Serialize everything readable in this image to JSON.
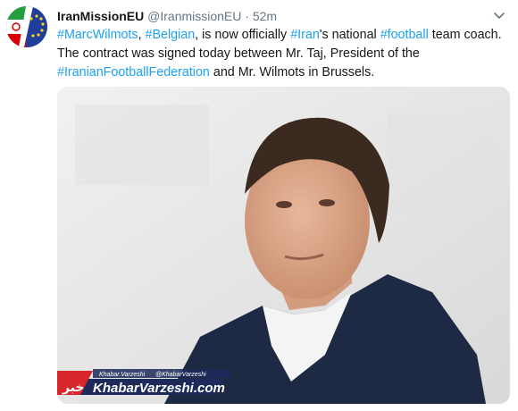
{
  "tweet": {
    "display_name": "IranMissionEU",
    "handle": "@IranmissionEU",
    "separator": "·",
    "time": "52m",
    "text_parts": [
      {
        "t": "#MarcWilmots",
        "tag": true
      },
      {
        "t": ", ",
        "tag": false
      },
      {
        "t": "#Belgian",
        "tag": true
      },
      {
        "t": ", is now officially ",
        "tag": false
      },
      {
        "t": "#Iran",
        "tag": true
      },
      {
        "t": "'s national ",
        "tag": false
      },
      {
        "t": "#football",
        "tag": true
      },
      {
        "t": " team coach. The contract was signed today between Mr. Taj, President of the ",
        "tag": false
      },
      {
        "t": "#IranianFootballFederation",
        "tag": true
      },
      {
        "t": " and Mr. Wilmots in Brussels.",
        "tag": false
      }
    ]
  },
  "watermark": {
    "credit_left": "Khabar.Varzeshi",
    "credit_right": "@KhabarVarzeshi",
    "brand_a": "Khabar",
    "brand_b": "Varzeshi",
    "brand_c": ".com",
    "logo_glyph": "خبر"
  },
  "colors": {
    "link": "#1da1f2",
    "name": "#14171a",
    "meta": "#657786",
    "brand_red": "#d7262b",
    "brand_navy": "#1d2a5a"
  },
  "icons": {
    "menu": "chevron-down-icon",
    "avatar": "flag-avatar-icon"
  }
}
